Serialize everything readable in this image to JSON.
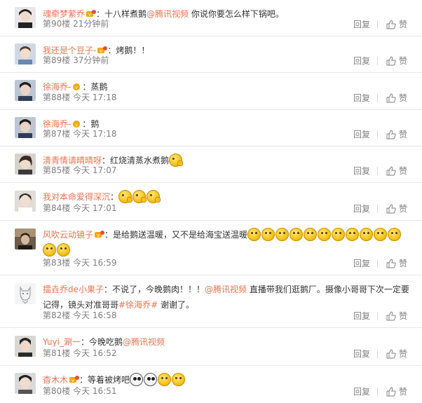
{
  "actions": {
    "reply": "回复",
    "like": "赞"
  },
  "colon": "：",
  "comments": [
    {
      "user": "魂牵梦萦乔",
      "text_parts": [
        "十八样煮鹅",
        "@腾讯视频",
        " 你说你要怎么样下锅吧。"
      ],
      "floor": "第90楼",
      "time": "21分钟前"
    },
    {
      "user": "我还是个豆子-",
      "text": "烤鹅！！",
      "floor": "第89楼",
      "time": "37分钟前"
    },
    {
      "user": "徐海乔-",
      "text": "蒸鹅",
      "floor": "第88楼",
      "time": "今天 17:18"
    },
    {
      "user": "徐海乔-",
      "text": "鹅",
      "floor": "第87楼",
      "time": "今天 17:18"
    },
    {
      "user": "清青情请晴晴呀",
      "text": "红烧清蒸水煮鹅",
      "floor": "第85楼",
      "time": "今天 17:07"
    },
    {
      "user": "我对本命爱得深沉",
      "text": "",
      "floor": "第84楼",
      "time": "今天 17:01"
    },
    {
      "user": "风吹云动镜子",
      "text": "是给鹅送温暖，又不是给海宝送温暖",
      "floor": "第83楼",
      "time": "今天 16:59"
    },
    {
      "user": "擂垚乔de小果子",
      "text_parts": [
        "不说了，今晚鹅肉！！！",
        "@腾讯视频",
        " 直播带我们逛鹅厂。摄像小哥哥下次一定要记得，镜头对准哥哥",
        "#徐海乔#",
        " 谢谢了。"
      ],
      "floor": "第82楼",
      "time": "今天 16:58"
    },
    {
      "user": "Yuyi_涮一",
      "text_parts": [
        "今晚吃鹅",
        "@腾讯视频"
      ],
      "floor": "第81楼",
      "time": "今天 16:52"
    },
    {
      "user": "杳木木",
      "text": "等着被烤吧",
      "floor": "第80楼",
      "time": "今天 16:51"
    }
  ]
}
